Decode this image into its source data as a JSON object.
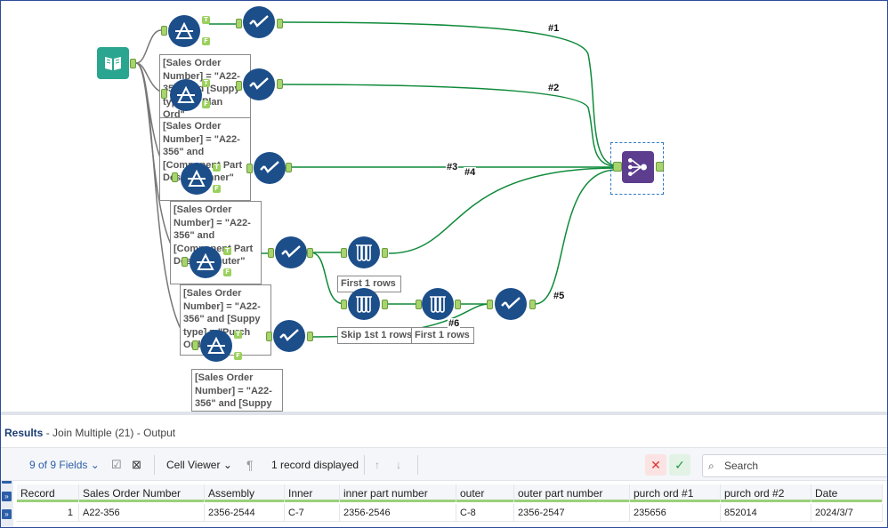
{
  "canvas": {
    "annotations": [
      "[Sales Order Number] = \"A22-356\" and [Suppy type] = \"Plan Ord\"",
      "[Sales Order Number] = \"A22-356\" and [Component Part Desc] = \"inner\"",
      "[Sales Order Number] = \"A22-356\" and [Component Part Desc] = \"outer\"",
      "[Sales Order Number] = \"A22-356\" and [Suppy type] = \"Purch Ord\"",
      "[Sales Order Number] = \"A22-356\" and [Suppy"
    ],
    "sample_labels": {
      "first1_a": "First 1 rows",
      "skip1": "Skip 1st 1 rows",
      "first1_b": "First 1 rows"
    },
    "wire_labels": {
      "w1": "#1",
      "w2": "#2",
      "w3": "#3",
      "w4": "#4",
      "w5": "#5",
      "w6": "#6"
    },
    "anchor_letters": {
      "true": "T",
      "false": "F"
    },
    "colors": {
      "wire": "#0f8a3a",
      "tool_blue": "#1c4e8a",
      "input_teal": "#2aa58f",
      "join_purple": "#5c3d8e",
      "anchor_green": "#a8d46f"
    }
  },
  "results": {
    "title": "Results",
    "subtitle": "- Join Multiple (21) - Output",
    "fields_label": "9 of 9 Fields",
    "viewer_label": "Cell Viewer",
    "records_label": "1 record displayed",
    "search_placeholder": "Search",
    "columns": [
      "Record",
      "Sales Order Number",
      "Assembly",
      "Inner",
      "inner part number",
      "outer",
      "outer part number",
      "purch ord #1",
      "purch ord #2",
      "Date"
    ],
    "rows": [
      [
        "1",
        "A22-356",
        "2356-2544",
        "C-7",
        "2356-2546",
        "C-8",
        "2356-2547",
        "235656",
        "852014",
        "2024/3/7"
      ]
    ]
  }
}
